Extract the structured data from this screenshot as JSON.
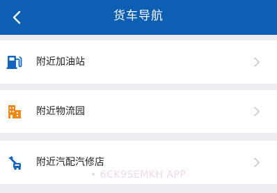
{
  "header": {
    "title": "货车导航",
    "back_icon": "chevron-left-icon",
    "background_color": "#0d5fb4"
  },
  "menu": {
    "items": [
      {
        "label": "附近加油站",
        "icon": "fuel-station-icon",
        "icon_color": "#1565c0"
      },
      {
        "label": "附近物流园",
        "icon": "logistics-park-icon",
        "icon_color": "#f08a1c"
      },
      {
        "label": "附近汽配汽修店",
        "icon": "repair-wrench-icon",
        "icon_color": "#1565c0"
      }
    ],
    "chevron_icon": "chevron-right-icon"
  },
  "watermark": {
    "text": "• 6CK9SEMKH APP"
  }
}
